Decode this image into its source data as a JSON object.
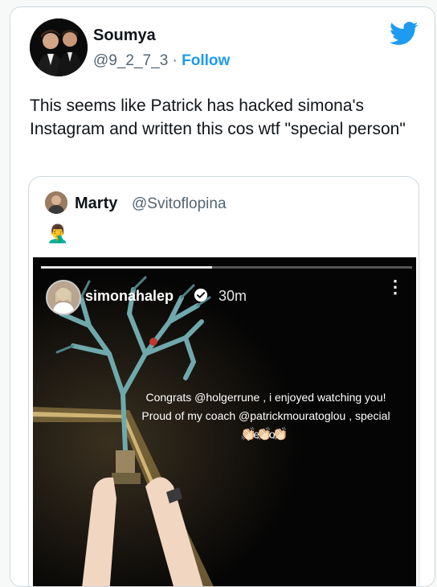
{
  "tweet": {
    "author_name": "Soumya",
    "author_handle": "@9_2_7_3",
    "separator": " · ",
    "follow_label": "Follow",
    "text": "This seems like Patrick has hacked simona's Instagram and written this cos wtf \"special person\""
  },
  "quoted": {
    "author_name": "Marty",
    "author_handle": "@Svitoflopina",
    "emoji": "🤦‍♂️",
    "story": {
      "username": "simonahalep",
      "time": "30m",
      "more_icon": "⋮",
      "caption_line1": "Congrats @holgerrune , i enjoyed watching you!",
      "caption_line2": "Proud of my coach @patrickmouratoglou , special person!",
      "claps": "👏🏻👏🏻👏🏻",
      "progress_fraction": 0.46
    }
  },
  "colors": {
    "twitter_blue": "#1d9bf0",
    "handle_gray": "#536471"
  }
}
